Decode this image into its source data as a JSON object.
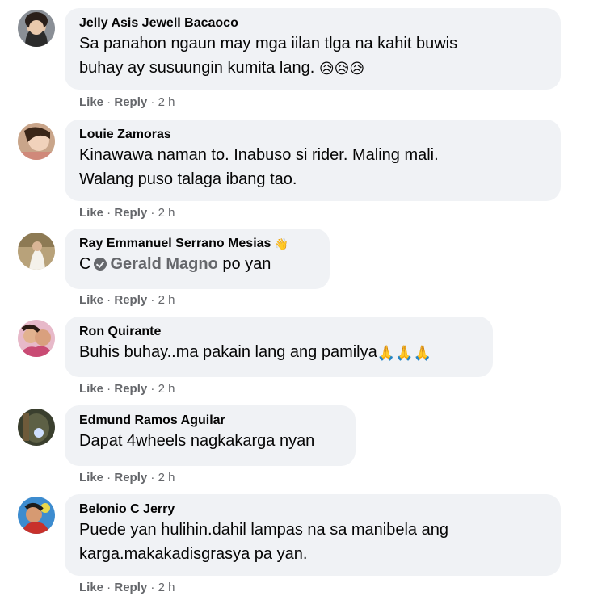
{
  "actions": {
    "like": "Like",
    "reply": "Reply",
    "sep": " · "
  },
  "comments": [
    {
      "author": "Jelly Asis Jewell Bacaoco",
      "line1": "Sa panahon ngaun may mga iilan tlga na kahit buwis",
      "line2": "buhay ay susuungin kumita lang.",
      "emoji": "😥😥😥",
      "time": "2 h"
    },
    {
      "author": "Louie Zamoras",
      "line1": "Kinawawa naman to. Inabuso si rider. Maling mali.",
      "line2": "Walang puso talaga ibang tao.",
      "time": "2 h"
    },
    {
      "author": "Ray Emmanuel Serrano Mesias",
      "author_emoji": "👋",
      "prefix": "C",
      "mention": "Gerald Magno",
      "suffix": "po yan",
      "time": "2 h"
    },
    {
      "author": "Ron Quirante",
      "line1": "Buhis buhay..ma pakain lang ang pamilya",
      "emoji": "🙏🙏🙏",
      "time": "2 h"
    },
    {
      "author": "Edmund Ramos Aguilar",
      "line1": "Dapat 4wheels nagkakarga nyan",
      "time": "2 h"
    },
    {
      "author": "Belonio C Jerry",
      "line1": "Puede yan hulihin.dahil lampas na sa manibela ang",
      "line2": "karga.makakadisgrasya pa yan.",
      "time": "2 h"
    }
  ],
  "colors": {
    "bubble": "#f0f2f5",
    "meta": "#65676b",
    "text": "#050505"
  }
}
